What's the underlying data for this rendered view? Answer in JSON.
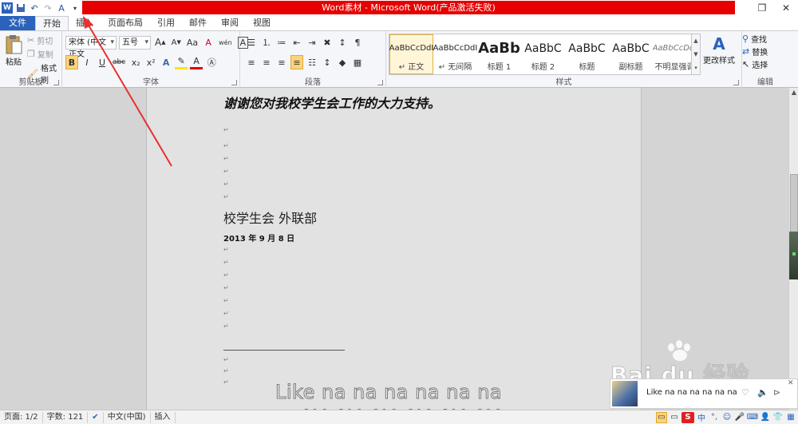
{
  "window": {
    "title": "Word素材 - Microsoft Word(产品激活失败)",
    "restore_icon": "restore-icon",
    "close_icon": "close-icon"
  },
  "qat": {
    "icons": [
      "word-app-icon",
      "save-icon",
      "undo-icon",
      "redo-icon",
      "spellcheck-icon",
      "customize-icon"
    ]
  },
  "tabs": [
    "文件",
    "开始",
    "插入",
    "页面布局",
    "引用",
    "邮件",
    "审阅",
    "视图"
  ],
  "ribbon": {
    "clipboard": {
      "paste": "粘贴",
      "cut": "剪切",
      "copy": "复制",
      "format_painter": "格式刷",
      "label": "剪贴板"
    },
    "font": {
      "font_name": "宋体 (中文正文",
      "font_size": "五号",
      "grow": "A",
      "shrink": "A",
      "case": "Aa",
      "clear": "A",
      "phonetic": "wén",
      "border_char": "A",
      "bold": "B",
      "italic": "I",
      "underline": "U",
      "strike": "abc",
      "subscript": "x₂",
      "superscript": "x²",
      "label": "字体"
    },
    "paragraph": {
      "label": "段落"
    },
    "styles": {
      "items": [
        {
          "sample": "AaBbCcDdI",
          "name": "↵ 正文"
        },
        {
          "sample": "AaBbCcDdI",
          "name": "↵ 无间隔"
        },
        {
          "sample": "AaBb",
          "name": "标题 1"
        },
        {
          "sample": "AaBbC",
          "name": "标题 2"
        },
        {
          "sample": "AaBbC",
          "name": "标题"
        },
        {
          "sample": "AaBbC",
          "name": "副标题"
        },
        {
          "sample": "AaBbCcDd.",
          "name": "不明显强调"
        }
      ],
      "change_styles": "更改样式",
      "label": "样式"
    },
    "editing": {
      "find": "查找",
      "replace": "替换",
      "select": "选择",
      "label": "编辑"
    }
  },
  "document": {
    "thanks": "谢谢您对我校学生会工作的大力支持。",
    "org": "校学生会  外联部",
    "date": "2013 年 9 月 8 日",
    "mark": "↵"
  },
  "lyrics": {
    "line1": "Like na na na na na na",
    "line2": "NA NA NA NA NA NA"
  },
  "watermark": {
    "text": "Bai du 经验"
  },
  "player": {
    "song": "Like na na na na na na"
  },
  "statusbar": {
    "page": "页面: 1/2",
    "words": "字数: 121",
    "language": "中文(中国)",
    "mode": "插入"
  },
  "ime": {
    "icons": [
      "sogou-icon",
      "chinese-mode-icon",
      "punctuation-icon",
      "emoji-icon",
      "mic-icon",
      "keyboard-icon",
      "skin-icon",
      "shirt-icon",
      "grid-icon"
    ],
    "labels": [
      "S",
      "中",
      "°,",
      "☺",
      "🎤",
      "⌨",
      "👤",
      "👕",
      "▦"
    ]
  }
}
